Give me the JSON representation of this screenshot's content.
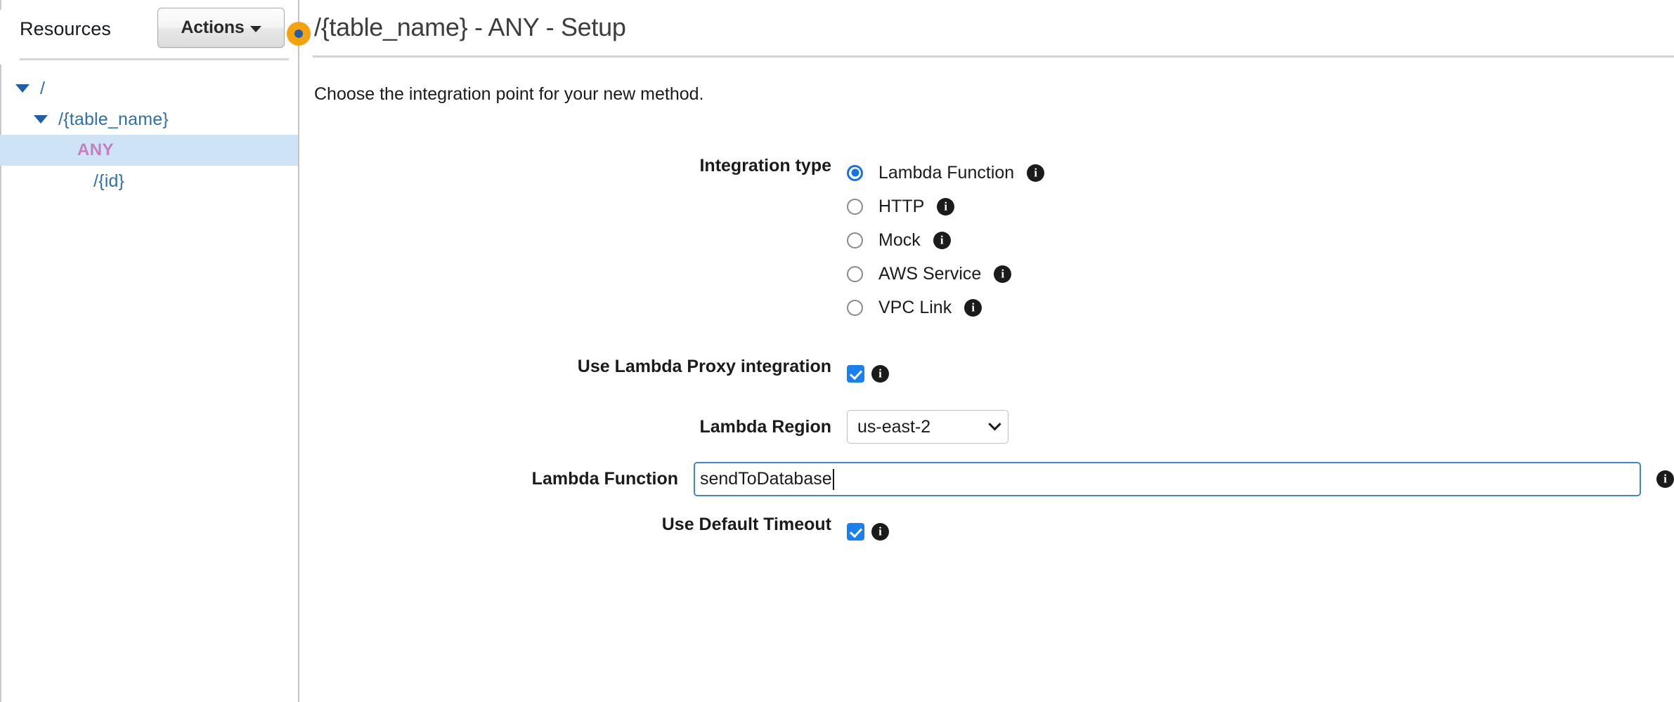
{
  "sidebar": {
    "heading": "Resources",
    "actions_button": {
      "label": "Actions",
      "icon": "caret-down-icon"
    },
    "tree": [
      {
        "label": "/",
        "depth": 0,
        "expanded": true,
        "selected": false
      },
      {
        "label": "/{table_name}",
        "depth": 1,
        "expanded": true,
        "selected": false
      },
      {
        "label": "ANY",
        "depth": 2,
        "expanded": false,
        "selected": true
      },
      {
        "label": "/{id}",
        "depth": 3,
        "expanded": false,
        "selected": false
      }
    ]
  },
  "main": {
    "title": "/{table_name} - ANY - Setup",
    "subtitle": "Choose the integration point for your new method.",
    "integration_type": {
      "label": "Integration type",
      "selected": "Lambda Function",
      "options": [
        {
          "label": "Lambda Function",
          "checked": true,
          "info": "info-icon"
        },
        {
          "label": "HTTP",
          "checked": false,
          "info": "info-icon"
        },
        {
          "label": "Mock",
          "checked": false,
          "info": "info-icon"
        },
        {
          "label": "AWS Service",
          "checked": false,
          "info": "info-icon"
        },
        {
          "label": "VPC Link",
          "checked": false,
          "info": "info-icon"
        }
      ]
    },
    "lambda_proxy": {
      "label": "Use Lambda Proxy integration",
      "checked": true,
      "info": "info-icon"
    },
    "lambda_region": {
      "label": "Lambda Region",
      "value": "us-east-2",
      "icon": "chevron-down-icon"
    },
    "lambda_function": {
      "label": "Lambda Function",
      "value": "sendToDatabase",
      "placeholder": "",
      "focused": true,
      "info": "info-icon"
    },
    "default_timeout": {
      "label": "Use Default Timeout",
      "checked": true,
      "info": "info-icon"
    }
  },
  "colors": {
    "accent_blue": "#1473e6",
    "checkbox_blue": "#1a80f0",
    "tree_link": "#2f6fad",
    "tree_selected_bg": "#cfe3f7",
    "tree_selected_text": "#c37fc0",
    "cursor_dot": "#f5a210",
    "cursor_dot_inner": "#1f5fa8",
    "input_focus_border": "#3f87cd"
  }
}
